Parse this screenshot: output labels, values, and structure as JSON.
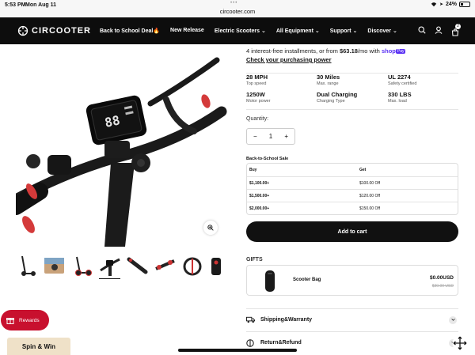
{
  "status_bar": {
    "time": "5:53 PM",
    "date": "Mon Aug 11",
    "url": "circooter.com",
    "battery": "24%"
  },
  "nav": {
    "logo": "CIRCOOTER",
    "menu": [
      {
        "label": "Back to School Deal🔥"
      },
      {
        "label": "New Release"
      },
      {
        "label": "Electric Scooters"
      },
      {
        "label": "All Equipment"
      },
      {
        "label": "Support"
      },
      {
        "label": "Discover"
      }
    ],
    "cart_count": "2"
  },
  "product": {
    "installments_prefix": "4 interest-free installments, or from ",
    "installment_amount": "$63.18",
    "installments_suffix": "/mo with ",
    "shop_word": "shop",
    "pay_badge": "Pay",
    "check_power": "Check your purchasing power",
    "specs": [
      {
        "value": "28 MPH",
        "label": "Top speed"
      },
      {
        "value": "30 Miles",
        "label": "Max. range"
      },
      {
        "value": "UL 2274",
        "label": "Safety certified"
      },
      {
        "value": "1250W",
        "label": "Motor power"
      },
      {
        "value": "Dual Charging",
        "label": "Charging Type"
      },
      {
        "value": "330 LBS",
        "label": "Max. load"
      }
    ],
    "quantity_label": "Quantity:",
    "quantity": "1",
    "sale": {
      "title": "Back-to-School Sale",
      "headers": [
        "Buy",
        "Get"
      ],
      "rows": [
        [
          "$1,100.00+",
          "$100.00 Off"
        ],
        [
          "$1,500.00+",
          "$120.00 Off"
        ],
        [
          "$2,000.00+",
          "$150.00 Off"
        ]
      ]
    },
    "add_to_cart": "Add to cart",
    "gifts_label": "GIFTS",
    "gift": {
      "name": "Scooter Bag",
      "price": "$0.00USD",
      "compare_price": "$30.00 USD"
    },
    "accordions": [
      {
        "label": "Shipping&Warranty"
      },
      {
        "label": "Return&Refund"
      }
    ]
  },
  "floating": {
    "rewards": "Rewards",
    "spin": "Spin & Win"
  },
  "colors": {
    "nav_bg": "#0d0d0d",
    "accent_red": "#c8102e",
    "shop_pay": "#5a31f4",
    "spin_bg": "#efe1c8"
  }
}
